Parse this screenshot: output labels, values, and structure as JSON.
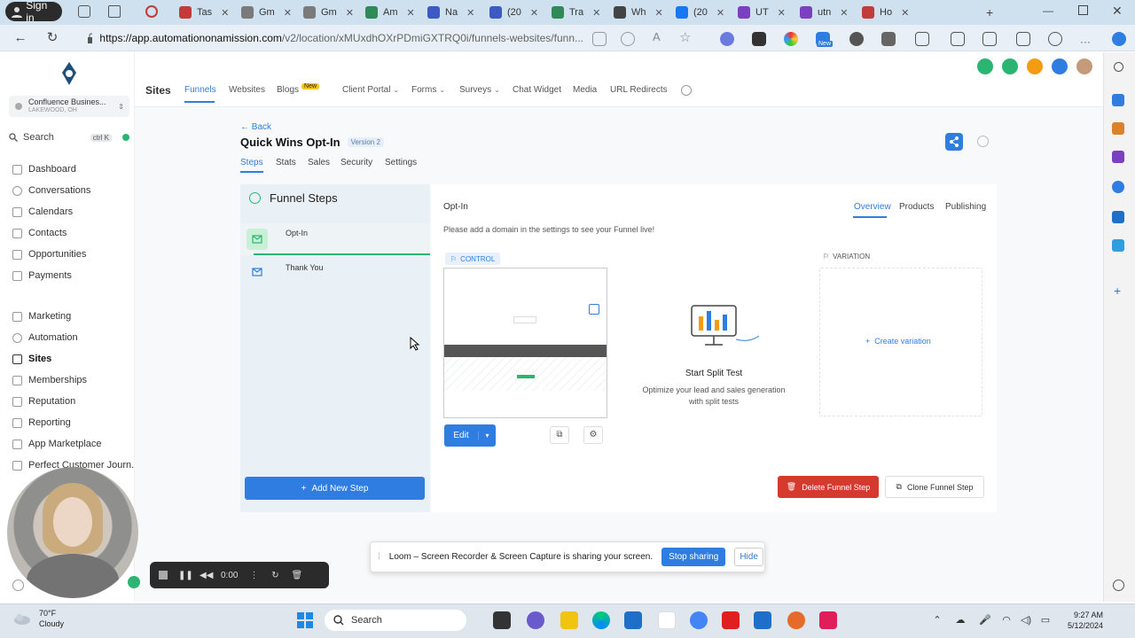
{
  "browser": {
    "signin_label": "Sign in",
    "tabs": [
      {
        "label": "Tas",
        "color": "#c23b3b"
      },
      {
        "label": "Gm",
        "color": "#7a7a7a"
      },
      {
        "label": "Gm",
        "color": "#7a7a7a"
      },
      {
        "label": "Am",
        "color": "#2e8b57"
      },
      {
        "label": "Na",
        "color": "#3b5bc2"
      },
      {
        "label": "(20",
        "color": "#3b5bc2"
      },
      {
        "label": "Tra",
        "color": "#2e8b57"
      },
      {
        "label": "Wh",
        "color": "#444"
      },
      {
        "label": "(20",
        "color": "#1877f2"
      },
      {
        "label": "UT",
        "color": "#7b3fc2"
      },
      {
        "label": "utn",
        "color": "#7b3fc2"
      },
      {
        "label": "Ho",
        "color": "#c23b3b"
      }
    ],
    "url_host": "https://app.automationonamission.com",
    "url_path": "/v2/location/xMUxdhOXrPDmiGXTRQ0i/funnels-websites/funn...",
    "new_label": "New"
  },
  "sidebar": {
    "account_name": "Confluence Busines...",
    "account_sub": "LAKEWOOD, OH",
    "search_label": "Search",
    "search_kbd": "ctrl K",
    "items": [
      {
        "label": "Dashboard"
      },
      {
        "label": "Conversations"
      },
      {
        "label": "Calendars"
      },
      {
        "label": "Contacts"
      },
      {
        "label": "Opportunities"
      },
      {
        "label": "Payments"
      },
      {
        "label": "Marketing"
      },
      {
        "label": "Automation"
      },
      {
        "label": "Sites"
      },
      {
        "label": "Memberships"
      },
      {
        "label": "Reputation"
      },
      {
        "label": "Reporting"
      },
      {
        "label": "App Marketplace"
      },
      {
        "label": "Perfect Customer Journ..."
      }
    ]
  },
  "topnav": {
    "title": "Sites",
    "items": [
      "Funnels",
      "Websites",
      "Blogs",
      "Client Portal",
      "Forms",
      "Surveys",
      "Chat Widget",
      "Media",
      "URL Redirects"
    ],
    "new_badge": "New"
  },
  "funnel": {
    "back_label": "Back",
    "title": "Quick Wins Opt-In",
    "version": "Version 2",
    "tabs": [
      "Steps",
      "Stats",
      "Sales",
      "Security",
      "Settings"
    ]
  },
  "steps_panel": {
    "heading": "Funnel Steps",
    "steps": [
      "Opt-In",
      "Thank You"
    ],
    "add_label": "Add New Step"
  },
  "detail": {
    "title": "Opt-In",
    "tabs": [
      "Overview",
      "Products",
      "Publishing"
    ],
    "domain_message": "Please add a domain in the settings to see your Funnel live!",
    "control_label": "CONTROL",
    "variation_label": "VARIATION",
    "edit_label": "Edit",
    "split_title": "Start Split Test",
    "split_desc": "Optimize your lead and sales generation with split tests",
    "create_variation": "Create variation",
    "delete_label": "Delete Funnel Step",
    "clone_label": "Clone Funnel Step"
  },
  "loom": {
    "message": "Loom – Screen Recorder & Screen Capture is sharing your screen.",
    "stop_label": "Stop sharing",
    "hide_label": "Hide",
    "timer": "0:00"
  },
  "taskbar": {
    "temp": "70°F",
    "condition": "Cloudy",
    "search_label": "Search",
    "time": "9:27 AM",
    "date": "5/12/2024"
  },
  "colors": {
    "accent": "#2f7de1",
    "success": "#2bb573",
    "danger": "#d63a2f"
  }
}
